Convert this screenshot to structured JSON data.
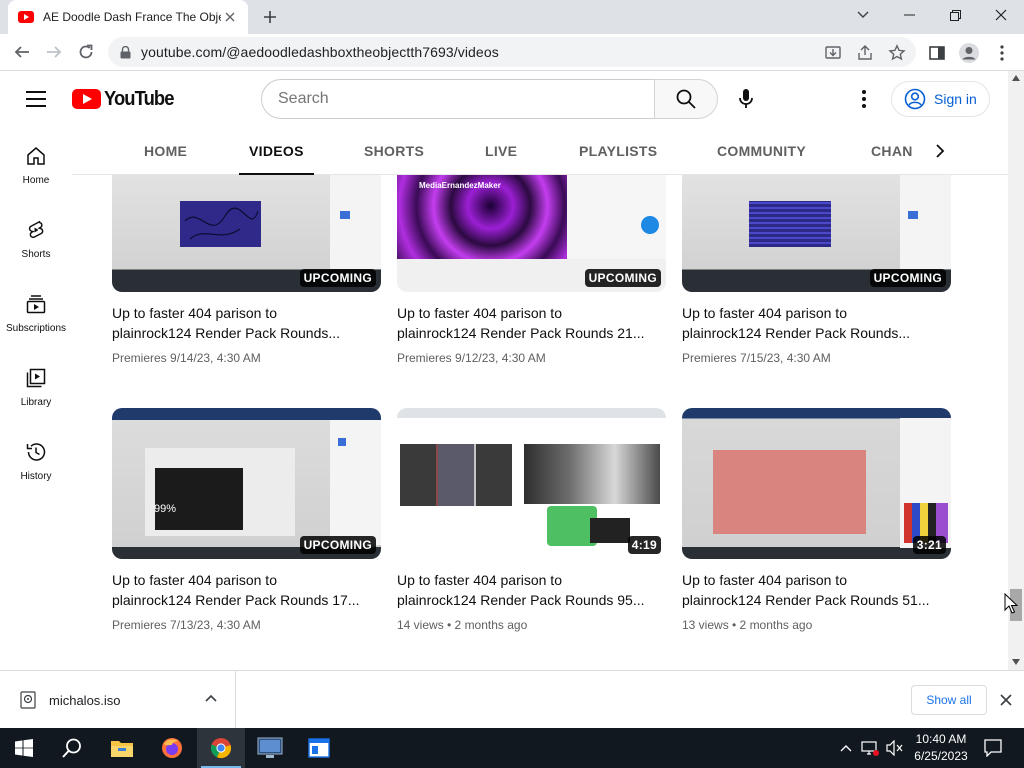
{
  "browser": {
    "tab_title": "AE Doodle Dash France The Object",
    "url": "youtube.com/@aedoodledashboxtheobjectth7693/videos"
  },
  "youtube": {
    "logo_text": "YouTube",
    "search_placeholder": "Search",
    "sign_in": "Sign in",
    "brand_color": "#ff0000",
    "tabs": [
      {
        "label": "HOME"
      },
      {
        "label": "VIDEOS"
      },
      {
        "label": "SHORTS"
      },
      {
        "label": "LIVE"
      },
      {
        "label": "PLAYLISTS"
      },
      {
        "label": "COMMUNITY"
      },
      {
        "label": "CHAN"
      }
    ],
    "active_tab": "VIDEOS",
    "guide": [
      {
        "label": "Home",
        "icon": "home-icon"
      },
      {
        "label": "Shorts",
        "icon": "shorts-icon"
      },
      {
        "label": "Subscriptions",
        "icon": "subscriptions-icon"
      },
      {
        "label": "Library",
        "icon": "library-icon"
      },
      {
        "label": "History",
        "icon": "history-icon"
      }
    ],
    "videos": [
      {
        "title_line1": "Up to faster 404 parison to",
        "title_line2": "plainrock124 Render Pack Rounds...",
        "meta": "Premieres 9/14/23, 4:30 AM",
        "badge": "UPCOMING"
      },
      {
        "title_line1": "Up to faster 404 parison to",
        "title_line2": "plainrock124 Render Pack Rounds 21...",
        "meta": "Premieres 9/12/23, 4:30 AM",
        "badge": "UPCOMING",
        "thumb_channel_text": "MediaErnandezMaker"
      },
      {
        "title_line1": "Up to faster 404 parison to",
        "title_line2": "plainrock124 Render Pack Rounds...",
        "meta": "Premieres 7/15/23, 4:30 AM",
        "badge": "UPCOMING"
      },
      {
        "title_line1": "Up to faster 404 parison to",
        "title_line2": "plainrock124 Render Pack Rounds 17...",
        "meta": "Premieres 7/13/23, 4:30 AM",
        "badge": "UPCOMING",
        "thumb_overlay_text": "99%"
      },
      {
        "title_line1": "Up to faster 404 parison to",
        "title_line2": "plainrock124 Render Pack Rounds 95...",
        "meta": "14 views • 2 months ago",
        "badge": "4:19"
      },
      {
        "title_line1": "Up to faster 404 parison to",
        "title_line2": "plainrock124 Render Pack Rounds 51...",
        "meta": "13 views • 2 months ago",
        "badge": "3:21"
      }
    ]
  },
  "downloads": {
    "file_name": "michalos.iso",
    "show_all": "Show all"
  },
  "taskbar": {
    "time": "10:40 AM",
    "date": "6/25/2023",
    "apps": [
      "start-icon",
      "search-icon",
      "file-explorer-icon",
      "firefox-icon",
      "chrome-icon",
      "monitor-app-icon",
      "window-app-icon"
    ]
  }
}
